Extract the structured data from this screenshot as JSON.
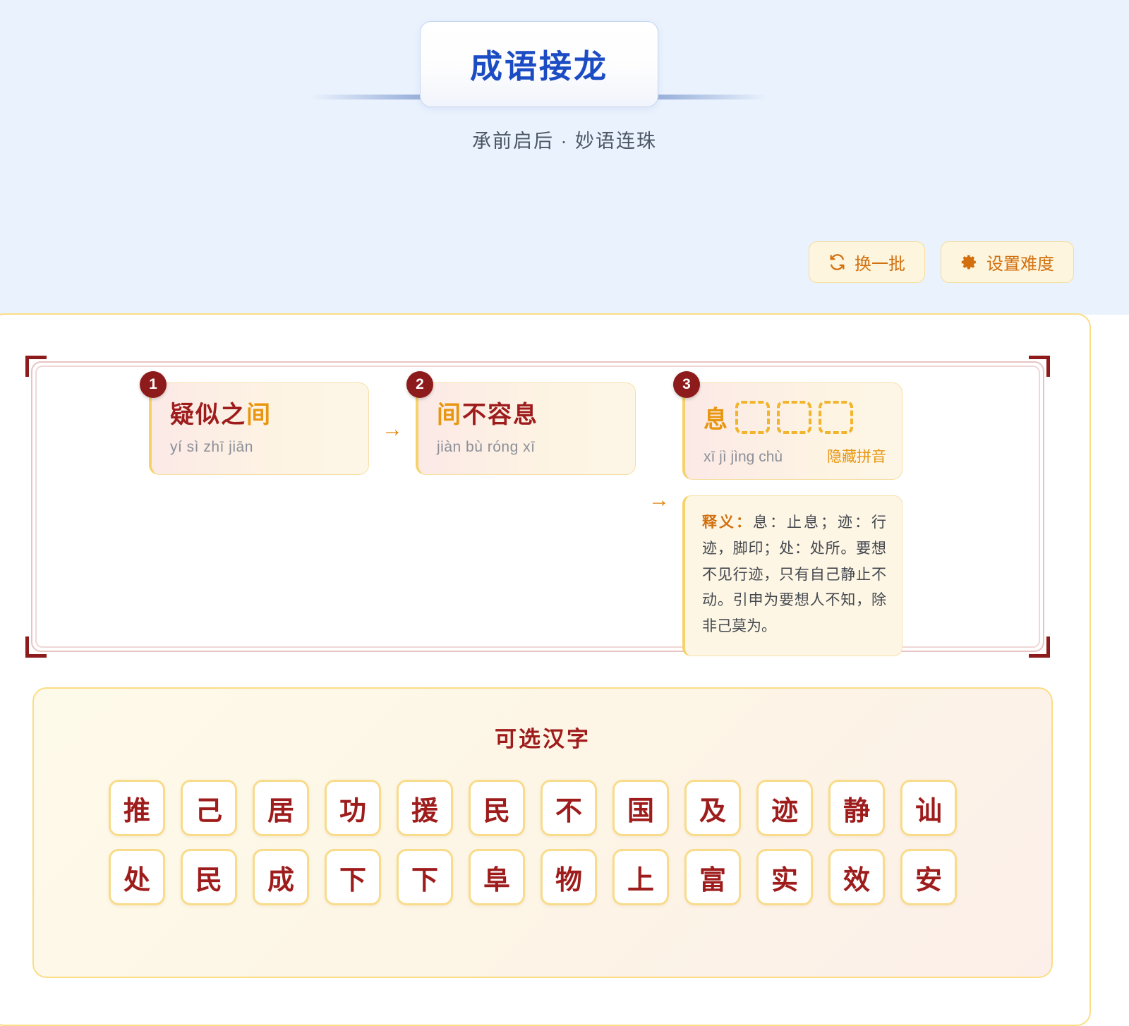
{
  "header": {
    "title": "成语接龙",
    "subtitle": "承前启后 · 妙语连珠"
  },
  "toolbar": {
    "refresh_label": "换一批",
    "refresh_icon": "refresh-icon",
    "difficulty_label": "设置难度",
    "difficulty_icon": "gear-icon"
  },
  "chain": {
    "arrow": "→",
    "items": [
      {
        "index": "1",
        "word_head": "疑似之",
        "word_link": "间",
        "pinyin": "yí sì zhī jiān"
      },
      {
        "index": "2",
        "word_link": "间",
        "word_tail": "不容息",
        "pinyin": "jiàn bù róng xī"
      }
    ],
    "active": {
      "index": "3",
      "known_char": "息",
      "blanks": 3,
      "pinyin": "xī jì jìng chù",
      "toggle_pinyin_label": "隐藏拼音",
      "definition_label": "释义：",
      "definition_text": "息：止息；迹：行迹，脚印；处：处所。要想不见行迹，只有自己静止不动。引申为要想人不知，除非己莫为。"
    }
  },
  "pool": {
    "title": "可选汉字",
    "characters": [
      "推",
      "己",
      "居",
      "功",
      "援",
      "民",
      "不",
      "国",
      "及",
      "迹",
      "静",
      "讪",
      "处",
      "民",
      "成",
      "下",
      "下",
      "阜",
      "物",
      "上",
      "富",
      "实",
      "效",
      "安"
    ]
  },
  "colors": {
    "header_bg": "#eaf2fd",
    "title_blue": "#1c4cc4",
    "accent_orange": "#e8960f",
    "deep_red": "#9e1c1c",
    "tile_border": "#f8dc8c"
  }
}
